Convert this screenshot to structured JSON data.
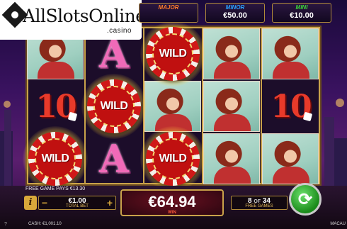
{
  "logo": {
    "text": "AllSlotsOnline",
    "sub": ".casino"
  },
  "jackpots": [
    {
      "name": "MAJOR",
      "value": "",
      "color": "#ff7a2a"
    },
    {
      "name": "MINOR",
      "value": "€50.00",
      "color": "#2aa0ff"
    },
    {
      "name": "MINI",
      "value": "€10.00",
      "color": "#3ad43a"
    }
  ],
  "reels": {
    "symbols": [
      [
        "woman",
        "ten",
        "wild"
      ],
      [
        "letter-a",
        "wild",
        "letter-a"
      ],
      [
        "wild",
        "woman",
        "wild"
      ],
      [
        "woman",
        "woman",
        "woman"
      ],
      [
        "woman",
        "ten",
        "woman"
      ]
    ],
    "wild_label": "WILD",
    "letter_a": "A",
    "ten": "10"
  },
  "status": {
    "free_game_pays": "FREE GAME PAYS €13.30",
    "info_label": "i",
    "bet_value": "€1.00",
    "bet_label": "TOTAL BET",
    "minus": "−",
    "plus": "+",
    "win_value": "€64.94",
    "win_label": "WIN",
    "free_games_current": "8",
    "free_games_of": "OF",
    "free_games_total": "34",
    "free_games_label": "FREE GAMES",
    "cash": "CASH: €1,001.10",
    "game_name": "MACAU",
    "help": "?"
  },
  "colors": {
    "accent_gold": "#c9a24a",
    "spin_green": "#1a8a1a",
    "chip_red": "#c01010"
  }
}
